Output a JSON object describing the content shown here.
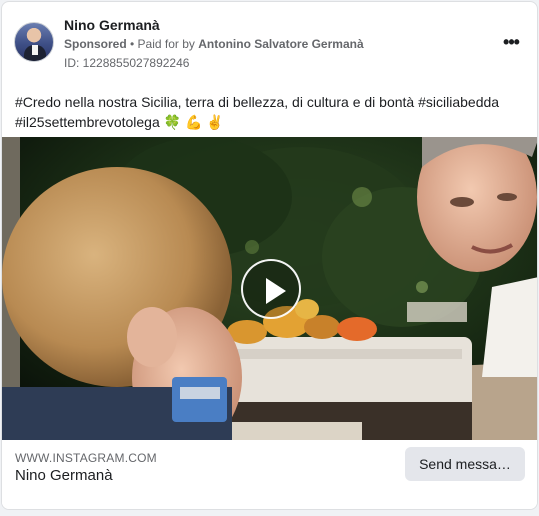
{
  "post": {
    "page_name": "Nino Germanà",
    "sponsored_label": "Sponsored",
    "paid_for_prefix": " • Paid for by ",
    "payer": "Antonino Salvatore Germanà",
    "ad_id": "ID: 1228855027892246",
    "more_icon": "more-options-icon",
    "caption": "#Credo nella nostra Sicilia, terra di bellezza, di cultura e di bontà #siciliabedda #il25settembrevotolega 🍀 💪 ✌️"
  },
  "media": {
    "type": "video",
    "play_icon": "play-icon"
  },
  "link": {
    "domain": "WWW.INSTAGRAM.COM",
    "title": "Nino Germanà",
    "cta_label": "Send messa…"
  }
}
